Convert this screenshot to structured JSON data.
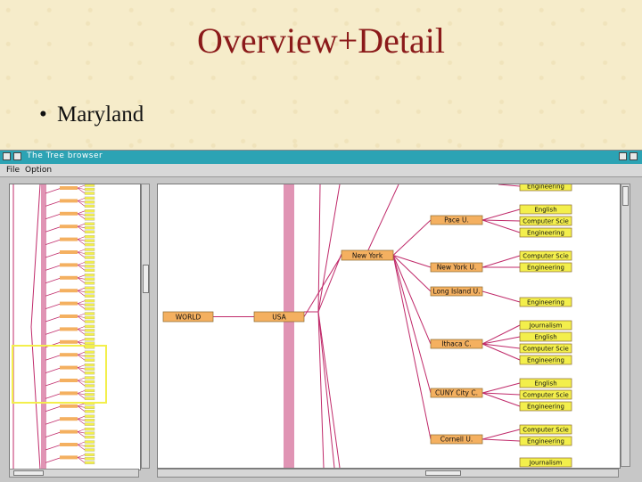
{
  "slide": {
    "title": "Overview+Detail",
    "bullet": "Maryland"
  },
  "window": {
    "title": "The Tree browser",
    "menu": {
      "file": "File",
      "option": "Option"
    }
  },
  "colors": {
    "title": "#8b1a1a",
    "edge": "#c02a6a",
    "node_orange": "#f4b060",
    "node_yellow": "#f3ef4c",
    "viewport_box": "#f3ef4c",
    "titlebar": "#2ca3b4"
  },
  "tree": {
    "root": "WORLD",
    "country": "USA",
    "state": "New York",
    "universities": [
      {
        "name": "Pace U.",
        "departments": [
          "English",
          "Computer Scie",
          "Engineering"
        ]
      },
      {
        "name": "New York U.",
        "departments": [
          "Computer Scie",
          "Engineering"
        ]
      },
      {
        "name": "Long Island U.",
        "departments": [
          "Engineering"
        ]
      },
      {
        "name": "Ithaca C.",
        "departments": [
          "Journalism",
          "English",
          "Computer Scie",
          "Engineering"
        ]
      },
      {
        "name": "CUNY City C.",
        "departments": [
          "English",
          "Computer Scie",
          "Engineering"
        ]
      },
      {
        "name": "Cornell U.",
        "departments": [
          "Computer Scie",
          "Engineering"
        ]
      }
    ],
    "partial_top": "Engineering",
    "partial_bottom": "Journalism"
  }
}
